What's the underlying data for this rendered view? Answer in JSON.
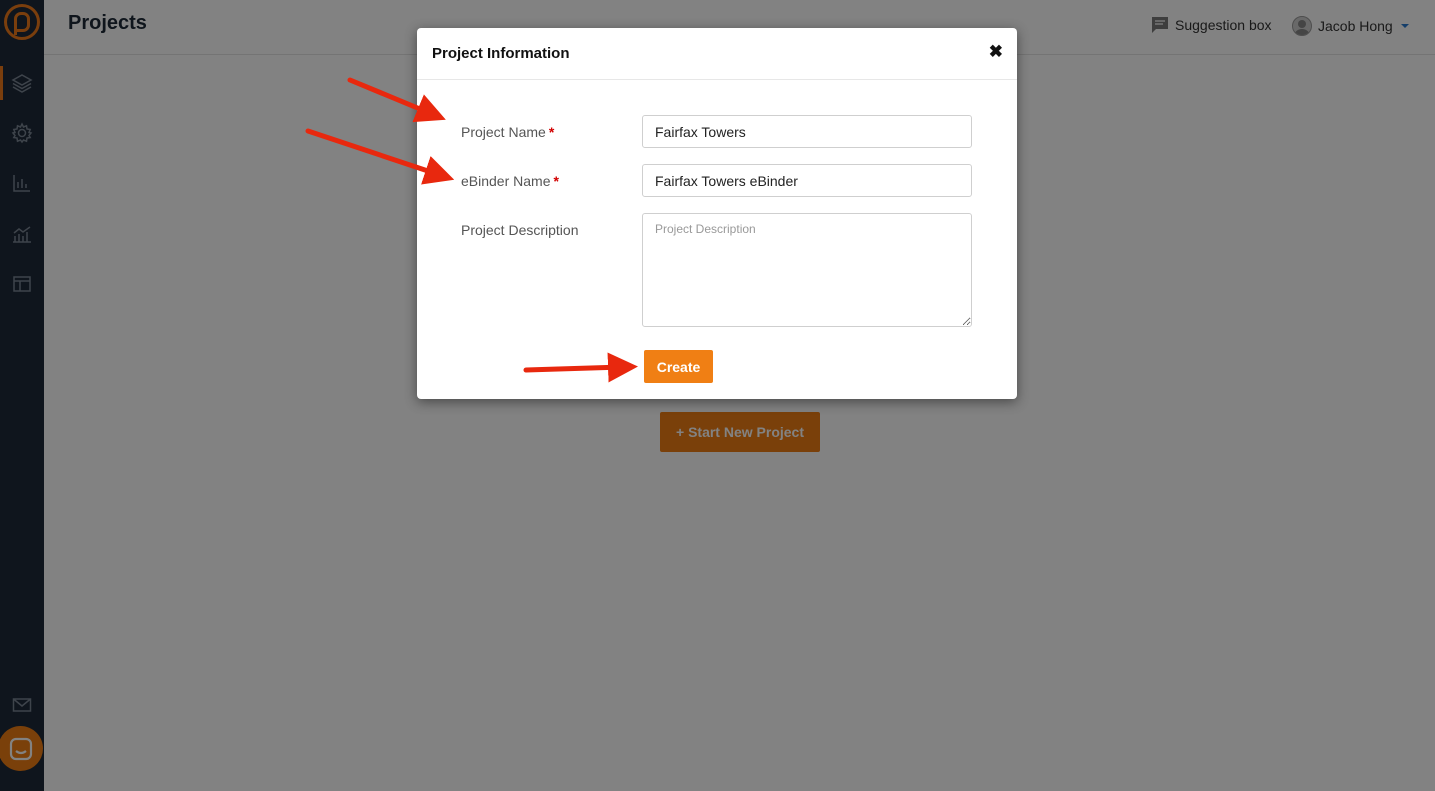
{
  "header": {
    "title": "Projects",
    "suggestion_label": "Suggestion box",
    "user_name": "Jacob Hong"
  },
  "sidebar": {
    "items": [
      {
        "icon": "layers-icon"
      },
      {
        "icon": "gear-icon"
      },
      {
        "icon": "bar-chart-icon"
      },
      {
        "icon": "analytics-icon"
      },
      {
        "icon": "layout-icon"
      },
      {
        "icon": "mail-icon"
      },
      {
        "icon": "chat-icon"
      }
    ]
  },
  "main": {
    "start_button_label": "+ Start New Project"
  },
  "modal": {
    "title": "Project Information",
    "close_symbol": "✖",
    "fields": {
      "project_name": {
        "label": "Project Name",
        "required": "*",
        "value": "Fairfax Towers"
      },
      "ebinder_name": {
        "label": "eBinder Name",
        "required": "*",
        "value": "Fairfax Towers eBinder"
      },
      "description": {
        "label": "Project Description",
        "placeholder": "Project Description",
        "value": ""
      }
    },
    "create_label": "Create"
  },
  "colors": {
    "accent": "#f07f14",
    "sidebar_bg": "#1f2a3a",
    "annotation_arrow": "#e8280e",
    "required": "#d20000"
  }
}
